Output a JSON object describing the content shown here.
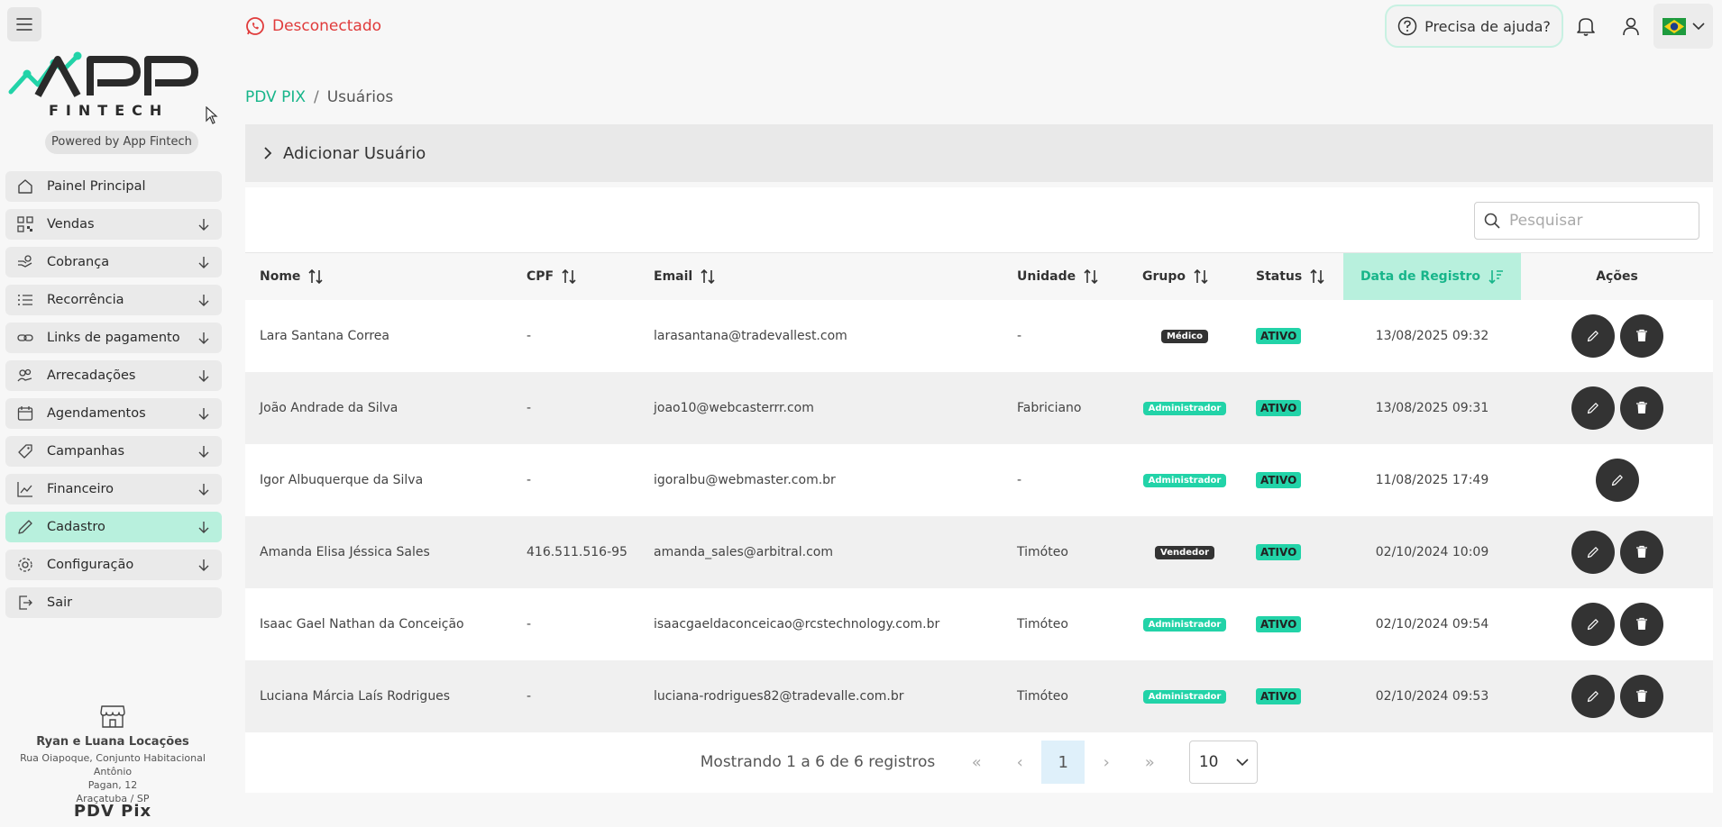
{
  "sidebar": {
    "logo_text": "APP",
    "logo_sub": "FINTECH",
    "powered_by": "Powered by App Fintech",
    "items": [
      {
        "label": "Painel Principal",
        "icon": "home-icon",
        "expandable": false
      },
      {
        "label": "Vendas",
        "icon": "qrcode-icon",
        "expandable": true
      },
      {
        "label": "Cobrança",
        "icon": "hand-money-icon",
        "expandable": true
      },
      {
        "label": "Recorrência",
        "icon": "list-icon",
        "expandable": true
      },
      {
        "label": "Links de pagamento",
        "icon": "link-icon",
        "expandable": true
      },
      {
        "label": "Arrecadações",
        "icon": "donation-icon",
        "expandable": true
      },
      {
        "label": "Agendamentos",
        "icon": "calendar-icon",
        "expandable": true
      },
      {
        "label": "Campanhas",
        "icon": "tag-icon",
        "expandable": true
      },
      {
        "label": "Financeiro",
        "icon": "chart-line-icon",
        "expandable": true
      },
      {
        "label": "Cadastro",
        "icon": "pencil-icon",
        "expandable": true,
        "active": true
      },
      {
        "label": "Configuração",
        "icon": "gear-icon",
        "expandable": true
      },
      {
        "label": "Sair",
        "icon": "logout-icon",
        "expandable": false
      }
    ],
    "store": {
      "name": "Ryan e Luana Locações",
      "address_line1": "Rua Oiapoque, Conjunto Habitacional Antônio",
      "address_line2": "Pagan, 12",
      "city": "Araçatuba / SP"
    },
    "footer": "PDV Pix"
  },
  "header": {
    "connection_status": "Desconectado",
    "help_label": "Precisa de ajuda?"
  },
  "breadcrumb": {
    "root": "PDV PIX",
    "separator": "/",
    "current": "Usuários"
  },
  "add_user": {
    "label": "Adicionar Usuário"
  },
  "search": {
    "placeholder": "Pesquisar"
  },
  "table": {
    "headers": {
      "nome": "Nome",
      "cpf": "CPF",
      "email": "Email",
      "unidade": "Unidade",
      "grupo": "Grupo",
      "status": "Status",
      "data": "Data de Registro",
      "acoes": "Ações"
    },
    "rows": [
      {
        "nome": "Lara Santana Correa",
        "cpf": "-",
        "email": "larasantana@tradevallest.com",
        "unidade": "-",
        "grupo": "Médico",
        "status": "ATIVO",
        "data": "13/08/2025 09:32",
        "can_delete": true
      },
      {
        "nome": "João Andrade da Silva",
        "cpf": "-",
        "email": "joao10@webcasterrr.com",
        "unidade": "Fabriciano",
        "grupo": "Administrador",
        "status": "ATIVO",
        "data": "13/08/2025 09:31",
        "can_delete": true
      },
      {
        "nome": "Igor Albuquerque da Silva",
        "cpf": "-",
        "email": "igoralbu@webmaster.com.br",
        "unidade": "-",
        "grupo": "Administrador",
        "status": "ATIVO",
        "data": "11/08/2025 17:49",
        "can_delete": false
      },
      {
        "nome": "Amanda Elisa Jéssica Sales",
        "cpf": "416.511.516-95",
        "email": "amanda_sales@arbitral.com",
        "unidade": "Timóteo",
        "grupo": "Vendedor",
        "status": "ATIVO",
        "data": "02/10/2024 10:09",
        "can_delete": true
      },
      {
        "nome": "Isaac Gael Nathan da Conceição",
        "cpf": "-",
        "email": "isaacgaeldaconceicao@rcstechnology.com.br",
        "unidade": "Timóteo",
        "grupo": "Administrador",
        "status": "ATIVO",
        "data": "02/10/2024 09:54",
        "can_delete": true
      },
      {
        "nome": "Luciana Márcia Laís Rodrigues",
        "cpf": "-",
        "email": "luciana-rodrigues82@tradevalle.com.br",
        "unidade": "Timóteo",
        "grupo": "Administrador",
        "status": "ATIVO",
        "data": "02/10/2024 09:53",
        "can_delete": true
      }
    ]
  },
  "pagination": {
    "info": "Mostrando 1 a 6 de 6 registros",
    "first": "«",
    "prev": "‹",
    "current_page": "1",
    "next": "›",
    "last": "»",
    "page_size": "10"
  },
  "colors": {
    "accent": "#17b58a",
    "badge_green": "#22d3a8",
    "active_bg": "#b8f0dd",
    "danger": "#e03b3b",
    "dark_button": "#333333"
  }
}
